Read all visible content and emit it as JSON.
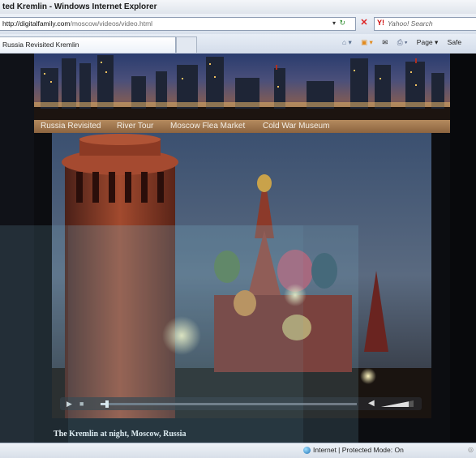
{
  "window": {
    "title": "ted Kremlin - Windows Internet Explorer"
  },
  "address": {
    "url_host": "http://digitalfamily.com",
    "url_path": "/moscow/videos/video.html"
  },
  "search": {
    "placeholder": "Yahoo! Search",
    "brand_glyph": "Y!"
  },
  "tab": {
    "label": "Russia Revisited Kremlin"
  },
  "commands": {
    "page": "Page ▾",
    "safety": "Safe"
  },
  "site": {
    "nav": [
      "Russia Revisited",
      "River Tour",
      "Moscow Flea Market",
      "Cold War Museum"
    ],
    "caption": "The Kremlin at night, Moscow, Russia"
  },
  "player": {
    "progress": 0.02,
    "volume": 0.85
  },
  "status": {
    "zone": "Internet | Protected Mode: On"
  },
  "colors": {
    "nav_bar": "#a07a52",
    "page_bg": "#0c0d11",
    "ie_chrome": "#dfe6ef",
    "accent_blue": "#1f6fb3"
  },
  "icons": [
    "refresh-icon",
    "stop-icon",
    "yahoo-icon",
    "home-icon",
    "feed-icon",
    "print-icon",
    "play-icon",
    "volume-icon",
    "globe-icon"
  ]
}
